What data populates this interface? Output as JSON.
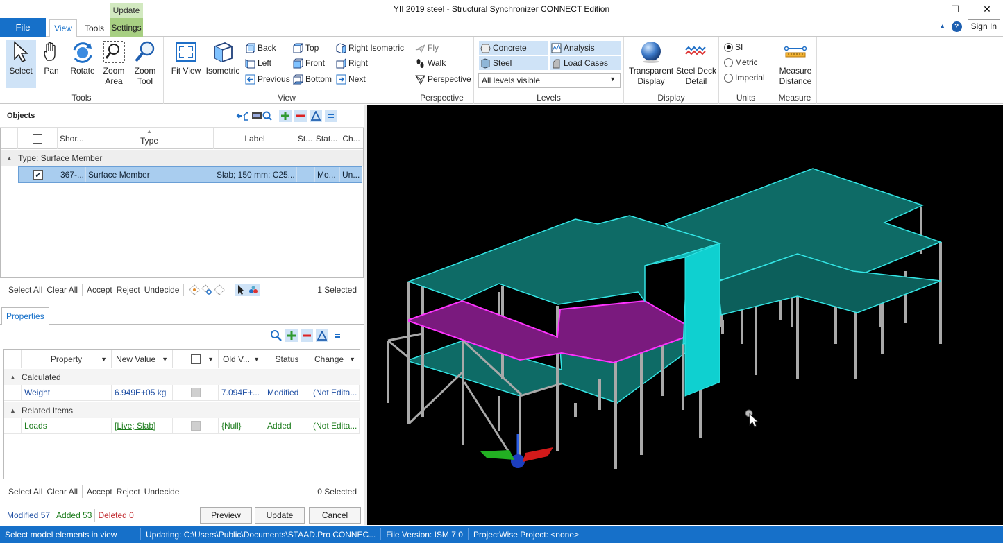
{
  "window": {
    "title": "YII 2019 steel - Structural Synchronizer CONNECT Edition",
    "minimize": "—",
    "maximize": "☐",
    "close": "✕"
  },
  "tabs": {
    "file": "File",
    "view": "View",
    "tools": "Tools",
    "context_group": "Update",
    "settings": "Settings",
    "sign_in": "Sign In",
    "help": "?"
  },
  "ribbon": {
    "tools_group": {
      "label": "Tools",
      "select": "Select",
      "pan": "Pan",
      "rotate": "Rotate",
      "zoom_area": [
        "Zoom",
        "Area"
      ],
      "zoom_tool": [
        "Zoom",
        "Tool"
      ]
    },
    "view_group": {
      "label": "View",
      "fit_view": "Fit View",
      "isometric": "Isometric",
      "back": "Back",
      "left": "Left",
      "previous": "Previous",
      "top": "Top",
      "front": "Front",
      "bottom": "Bottom",
      "right_isometric": "Right Isometric",
      "right": "Right",
      "next": "Next"
    },
    "perspective_group": {
      "label": "Perspective",
      "fly": "Fly",
      "walk": "Walk",
      "perspective": "Perspective"
    },
    "levels_group": {
      "label": "Levels",
      "concrete": "Concrete",
      "steel": "Steel",
      "analysis": "Analysis",
      "load_cases": "Load Cases",
      "levels_select": "All levels visible"
    },
    "display_group": {
      "label": "Display",
      "transparent": [
        "Transparent",
        "Display"
      ],
      "steel_deck": [
        "Steel Deck",
        "Detail"
      ]
    },
    "units_group": {
      "label": "Units",
      "si": "SI",
      "metric": "Metric",
      "imperial": "Imperial",
      "selected": "SI"
    },
    "measure_group": {
      "label": "Measure",
      "measure_distance": [
        "Measure",
        "Distance"
      ]
    }
  },
  "objects": {
    "title": "Objects",
    "columns": [
      "Shor...",
      "Type",
      "Label",
      "St...",
      "Stat...",
      "Ch..."
    ],
    "group_label": "Type: Surface Member",
    "rows": [
      {
        "short": "367-...",
        "type": "Surface Member",
        "label": "Slab; 150 mm; C25...",
        "st": "",
        "status": "Mo...",
        "change": "Un..."
      }
    ],
    "actions": [
      "Select All",
      "Clear All",
      "Accept",
      "Reject",
      "Undecide"
    ],
    "selected_count": "1 Selected"
  },
  "properties": {
    "tab": "Properties",
    "columns": [
      "Property",
      "New Value",
      "Old V...",
      "Status",
      "Change"
    ],
    "groups": [
      {
        "label": "Calculated",
        "rows": [
          {
            "property": "Weight",
            "new_value": "6.949E+05 kg",
            "old_value": "7.094E+...",
            "status": "Modified",
            "change": "(Not Edita..."
          }
        ]
      },
      {
        "label": "Related Items",
        "rows": [
          {
            "property": "Loads",
            "new_value": "[Live; Slab]",
            "old_value": "{Null}",
            "status": "Added",
            "change": "(Not Edita..."
          }
        ]
      }
    ],
    "actions": [
      "Select All",
      "Clear All",
      "Accept",
      "Reject",
      "Undecide"
    ],
    "selected_count": "0 Selected"
  },
  "footer": {
    "modified": "Modified 57",
    "added": "Added 53",
    "deleted": "Deleted 0",
    "preview": "Preview",
    "update": "Update",
    "cancel": "Cancel"
  },
  "status_bar": {
    "hint": "Select model elements in view",
    "updating": "Updating:  C:\\Users\\Public\\Documents\\STAAD.Pro  CONNEC...",
    "file_version": "File Version: ISM 7.0",
    "projectwise": "ProjectWise Project: <none>"
  },
  "colors": {
    "accent": "#1670c9",
    "settings_tab": "#a7cf82",
    "selection": "#a9cdef",
    "slab_concrete": "#0e6b66",
    "slab_modified": "#7a1a7e",
    "edge": "#33e6e6",
    "column": "#a9a9a9",
    "viewport_bg": "#000000",
    "modified_text": "#1f4fa3",
    "added_text": "#1e7d1e",
    "deleted_text": "#c0282d"
  }
}
